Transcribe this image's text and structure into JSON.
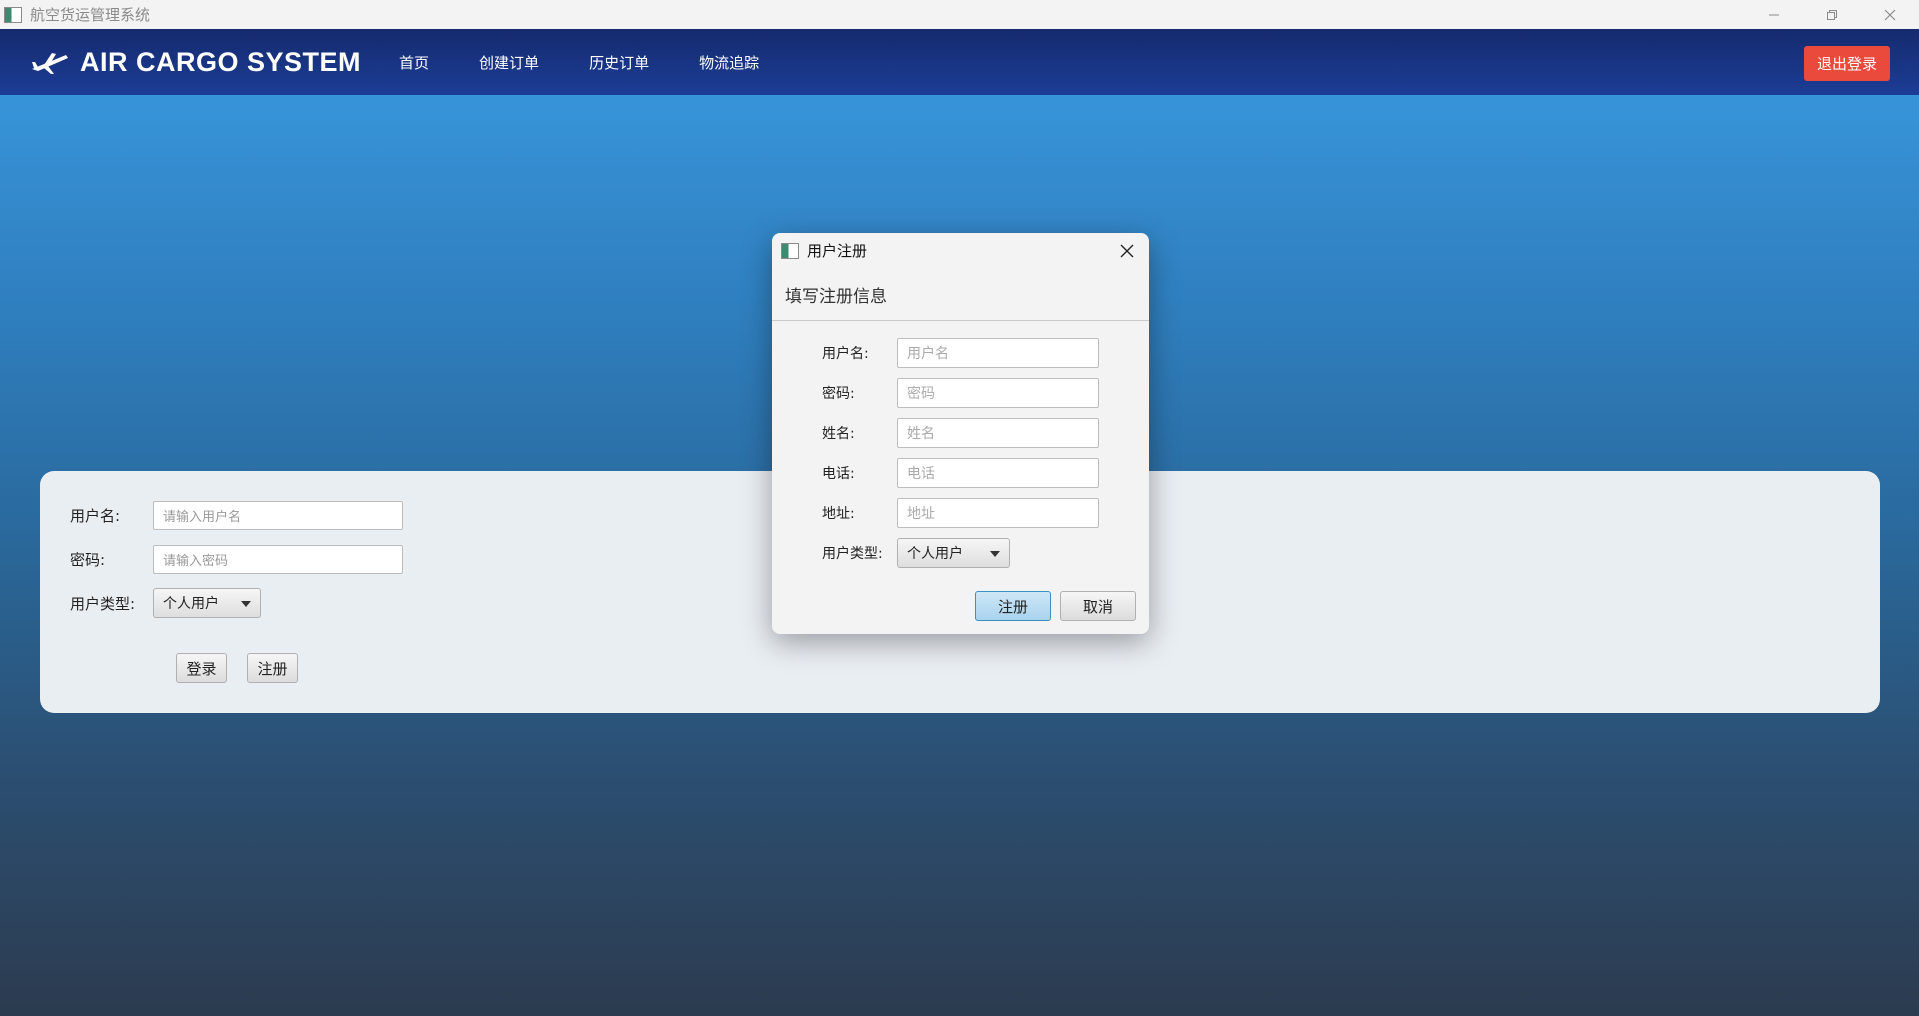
{
  "window": {
    "title": "航空货运管理系统"
  },
  "navbar": {
    "brand": "AIR CARGO SYSTEM",
    "links": [
      "首页",
      "创建订单",
      "历史订单",
      "物流追踪"
    ],
    "logout": "退出登录"
  },
  "login": {
    "username_label": "用户名:",
    "username_placeholder": "请输入用户名",
    "password_label": "密码:",
    "password_placeholder": "请输入密码",
    "usertype_label": "用户类型:",
    "usertype_value": "个人用户",
    "login_button": "登录",
    "register_button": "注册"
  },
  "dialog": {
    "title": "用户注册",
    "header": "填写注册信息",
    "fields": [
      {
        "label": "用户名:",
        "placeholder": "用户名"
      },
      {
        "label": "密码:",
        "placeholder": "密码"
      },
      {
        "label": "姓名:",
        "placeholder": "姓名"
      },
      {
        "label": "电话:",
        "placeholder": "电话"
      },
      {
        "label": "地址:",
        "placeholder": "地址"
      }
    ],
    "usertype_label": "用户类型:",
    "usertype_value": "个人用户",
    "register_button": "注册",
    "cancel_button": "取消"
  },
  "colors": {
    "logout": "#e94a3c",
    "navbar": "#1c3d96"
  }
}
